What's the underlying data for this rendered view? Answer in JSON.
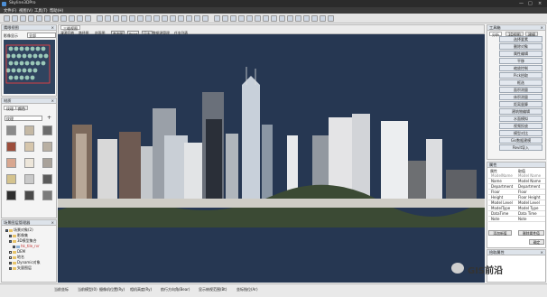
{
  "app": {
    "title": "Skyline3DPro",
    "window_controls": [
      "—",
      "□",
      "×"
    ]
  },
  "menu": [
    "文件(F)",
    "视图(V)",
    "工具(T)",
    "帮助(H)"
  ],
  "viewport_tabs": {
    "main_tab": "三维视图",
    "subtabs": [
      "漫游回放",
      "路径图",
      "剖面图",
      "查询图",
      "Point",
      "日志",
      "数据源管理",
      "任务列表"
    ]
  },
  "left": {
    "overview": {
      "title": "鹰眼视图",
      "label": "影像显示",
      "select": "全部"
    },
    "materials": {
      "title": "材质",
      "tabs": [
        "纹理",
        "颜色"
      ],
      "select": "纹理"
    },
    "scene_tree": {
      "title": "场景图层管理器",
      "rows": [
        {
          "text": "场景对象(2)",
          "level": 0,
          "checked": true
        },
        {
          "text": "影像集",
          "level": 1,
          "checked": true
        },
        {
          "text": "3D模型集合",
          "level": 1,
          "checked": true
        },
        {
          "text": "hk_tile_rvr",
          "level": 2,
          "checked": true,
          "highlight": true
        },
        {
          "text": "DEM",
          "level": 1,
          "checked": false
        },
        {
          "text": "地名",
          "level": 1,
          "checked": false
        },
        {
          "text": "Dynamic对象",
          "level": 1,
          "checked": true
        },
        {
          "text": "矢量图层",
          "level": 1,
          "checked": true
        }
      ]
    }
  },
  "right": {
    "tools": {
      "title": "工具箱",
      "tabs": [
        "分析",
        "3D视图",
        "建模"
      ],
      "buttons": [
        "选择要素",
        "删除对象",
        "属性编辑",
        "平移",
        "缩放控制",
        "Pick拾取",
        "框选",
        "面积测量",
        "体积测量",
        "距离量算",
        "建筑物编辑",
        "水面模拟",
        "视频投放",
        "模型对比",
        "Gis数据建模",
        "Revit导入"
      ]
    },
    "properties": {
      "title": "属性",
      "headers": [
        "属性",
        "取值"
      ],
      "rows": [
        [
          "ModelName",
          "Model Name"
        ],
        [
          "Name",
          "Model Name"
        ],
        [
          "Department",
          "Department"
        ],
        [
          "Floor",
          "Floor"
        ],
        [
          "Height",
          "Floor Height"
        ],
        [
          "Model Level",
          "Model Level"
        ],
        [
          "ModelType",
          "Model Type"
        ],
        [
          "DataTime",
          "Data Time"
        ],
        [
          "Note",
          "Note"
        ]
      ],
      "buttons": [
        "添加新值",
        "删除属性值"
      ],
      "save": "确定"
    },
    "pick": {
      "title": "拾取属性",
      "close": "×"
    }
  },
  "status": [
    "当前坐标",
    "当前模型(0)",
    "摄像机位置(Ry)",
    "相机高度(Ry)",
    "航行方向角(Bear)",
    "显示俯视范围(Bt)",
    "坐标指位(Ar)"
  ],
  "watermark": "GIS前沿",
  "colors": {
    "viewport_bg": "#263752",
    "accent": "#3c6ea8",
    "panel_header": "#dde3ea"
  }
}
